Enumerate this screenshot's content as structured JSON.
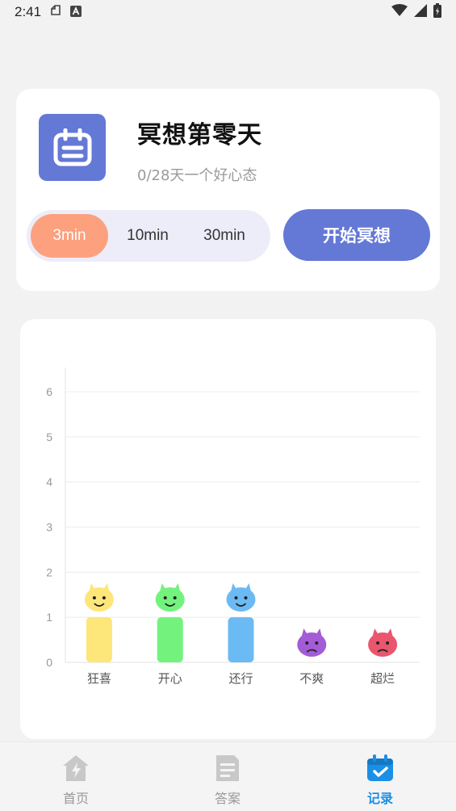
{
  "status_bar": {
    "time": "2:41"
  },
  "meditation": {
    "title": "冥想第零天",
    "subtitle": "0/28天一个好心态",
    "durations": [
      "3min",
      "10min",
      "30min"
    ],
    "selected_duration": "3min",
    "start_label": "开始冥想"
  },
  "chart_data": {
    "type": "bar",
    "categories": [
      "狂喜",
      "开心",
      "还行",
      "不爽",
      "超烂"
    ],
    "values": [
      1,
      1,
      1,
      0,
      0
    ],
    "ylim": [
      0,
      6
    ],
    "yticks": [
      "0",
      "1",
      "2",
      "3",
      "4",
      "5",
      "6"
    ],
    "colors": [
      "#fde67a",
      "#73f27e",
      "#6cbaf3",
      "#a35bd6",
      "#e9566e"
    ],
    "grid": true
  },
  "tabbar": {
    "items": [
      {
        "label": "首页",
        "icon": "home-bolt-icon",
        "active": false
      },
      {
        "label": "答案",
        "icon": "document-icon",
        "active": false
      },
      {
        "label": "记录",
        "icon": "calendar-check-icon",
        "active": true
      }
    ]
  },
  "colors": {
    "primary": "#6478d6",
    "accent": "#fda07e",
    "tab_active": "#1b8fe3"
  }
}
